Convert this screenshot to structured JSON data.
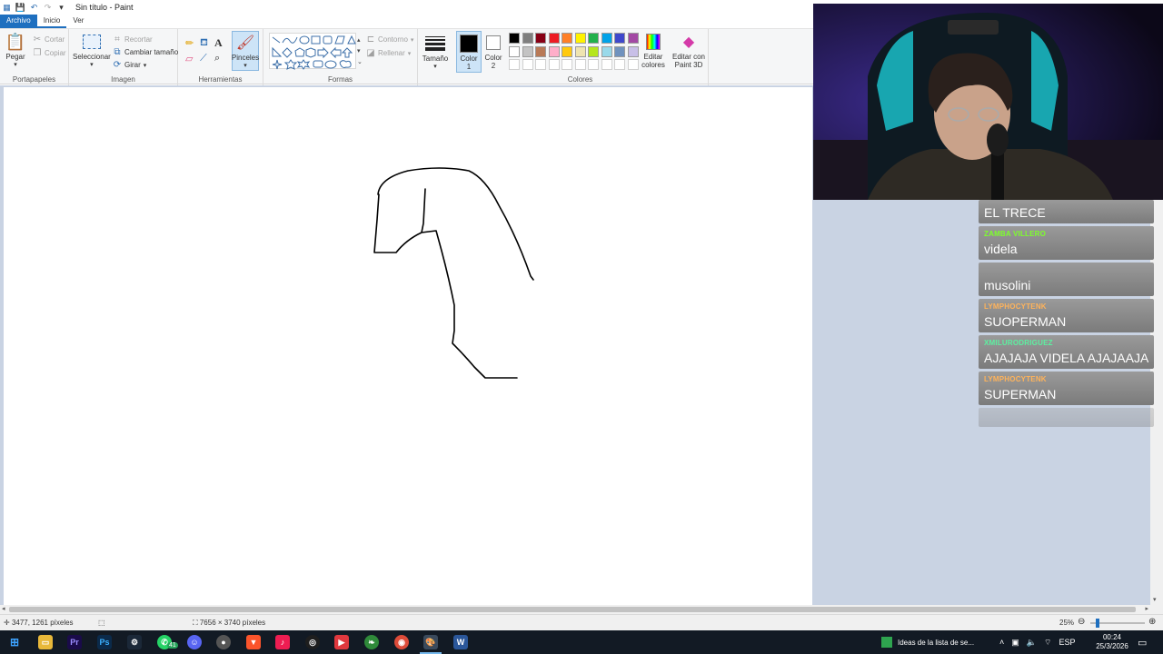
{
  "window": {
    "title": "Sin título - Paint"
  },
  "tabs": [
    "Archivo",
    "Inicio",
    "Ver"
  ],
  "ribbon": {
    "clipboard": {
      "paste": "Pegar",
      "cut": "Cortar",
      "copy": "Copiar",
      "label": "Portapapeles"
    },
    "image": {
      "select": "Seleccionar",
      "crop": "Recortar",
      "resize": "Cambiar tamaño",
      "rotate": "Girar",
      "label": "Imagen"
    },
    "tools": {
      "label": "Herramientas",
      "brushes": "Pinceles"
    },
    "shapes": {
      "outline": "Contorno",
      "fill": "Rellenar",
      "label": "Formas"
    },
    "size": "Tamaño",
    "color1": "Color 1",
    "color2": "Color 2",
    "colors": {
      "label": "Colores",
      "edit": "Editar colores",
      "paint3d": "Editar con Paint 3D",
      "row1": [
        "#000000",
        "#7f7f7f",
        "#880015",
        "#ed1c24",
        "#ff7f27",
        "#fff200",
        "#22b14c",
        "#00a2e8",
        "#3f48cc",
        "#a349a4"
      ],
      "row2": [
        "#ffffff",
        "#c3c3c3",
        "#b97a57",
        "#ffaec9",
        "#ffc90e",
        "#efe4b0",
        "#b5e61d",
        "#99d9ea",
        "#7092be",
        "#c8bfe7"
      ]
    }
  },
  "status": {
    "cursor": "3477, 1261 píxeles",
    "canvas_size": "7656 × 3740 píxeles",
    "zoom": "25%"
  },
  "taskbar": {
    "notification": "Ideas de la lista de se...",
    "lang": "ESP",
    "time": "00:24",
    "date": "25/3/2026",
    "whatsapp_badge": "41"
  },
  "chat": [
    {
      "user": "",
      "text": "EL TRECE",
      "user_color": "#ffffff"
    },
    {
      "user": "ZAMBA VILLERO",
      "text": "videla",
      "user_color": "#7dff2a"
    },
    {
      "user": "",
      "text": "musolini",
      "user_color": "#ff8c1a"
    },
    {
      "user": "LYMPHOCYTENK",
      "text": "SUOPERMAN",
      "user_color": "#ffb35a"
    },
    {
      "user": "XMILURODRIGUEZ",
      "text": "AJAJAJA VIDELA AJAJAAJA",
      "user_color": "#5cf0a0"
    },
    {
      "user": "LYMPHOCYTENK",
      "text": "SUPERMAN",
      "user_color": "#ffb35a"
    },
    {
      "user": "",
      "text": "",
      "user_color": "#ffb35a"
    }
  ]
}
